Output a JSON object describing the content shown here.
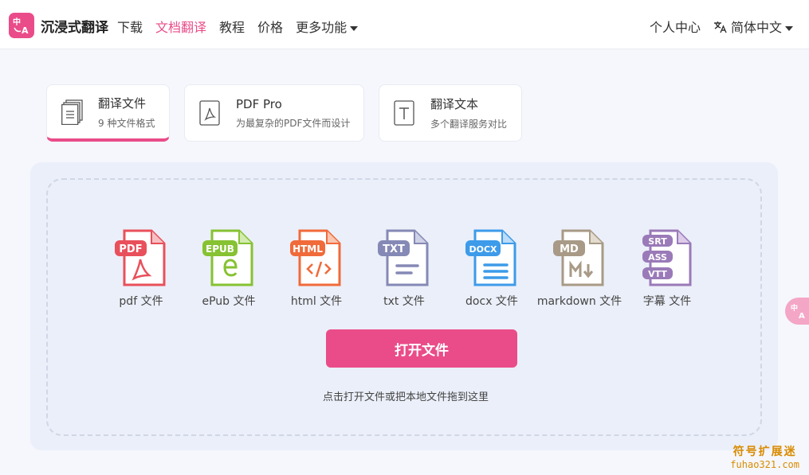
{
  "header": {
    "brand": "沉浸式翻译",
    "nav": [
      "下载",
      "文档翻译",
      "教程",
      "价格",
      "更多功能"
    ],
    "user_center": "个人中心",
    "language": "简体中文",
    "accent": "#ea4c89"
  },
  "tabs": [
    {
      "title": "翻译文件",
      "sub": "9 种文件格式"
    },
    {
      "title": "PDF Pro",
      "sub": "为最复杂的PDF文件而设计"
    },
    {
      "title": "翻译文本",
      "sub": "多个翻译服务对比"
    }
  ],
  "file_types": [
    {
      "badge": "PDF",
      "label": "pdf 文件",
      "color": "#e8505b"
    },
    {
      "badge": "EPUB",
      "label": "ePub 文件",
      "color": "#86c232"
    },
    {
      "badge": "HTML",
      "label": "html 文件",
      "color": "#f06a3a"
    },
    {
      "badge": "TXT",
      "label": "txt 文件",
      "color": "#8589b5"
    },
    {
      "badge": "DOCX",
      "label": "docx 文件",
      "color": "#3d9be9"
    },
    {
      "badge": "MD",
      "label": "markdown 文件",
      "color": "#a89a86"
    },
    {
      "badge": "SRT",
      "badge2": "ASS",
      "badge3": "VTT",
      "label": "字幕 文件",
      "color": "#9a7ab8"
    }
  ],
  "open_button": "打开文件",
  "hint": "点击打开文件或把本地文件拖到这里",
  "watermark": {
    "line1": "符号扩展迷",
    "line2": "fuhao321.com"
  }
}
